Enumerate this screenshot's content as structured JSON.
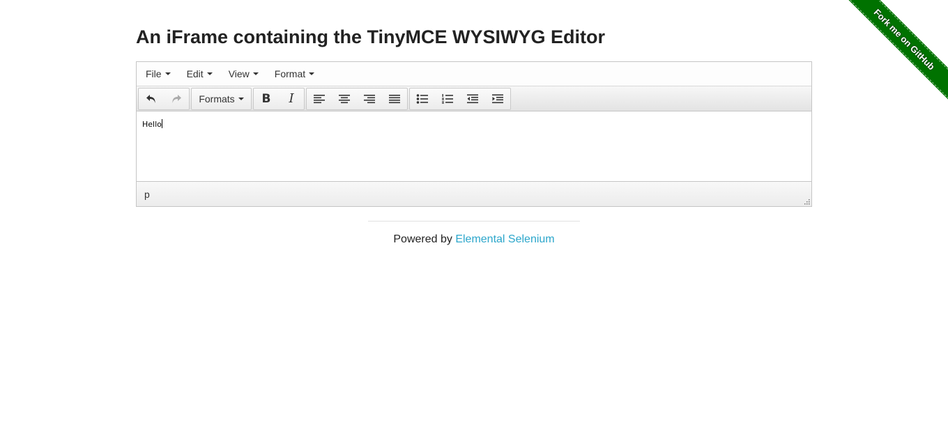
{
  "ribbon": {
    "label": "Fork me on GitHub",
    "color": "#007200"
  },
  "page": {
    "title": "An iFrame containing the TinyMCE WYSIWYG Editor"
  },
  "menubar": {
    "items": [
      {
        "label": "File"
      },
      {
        "label": "Edit"
      },
      {
        "label": "View"
      },
      {
        "label": "Format"
      }
    ]
  },
  "toolbar": {
    "formats_label": "Formats",
    "bold_glyph": "B",
    "italic_glyph": "I",
    "icons": [
      "undo-icon",
      "redo-icon",
      "bold-icon",
      "italic-icon",
      "align-left-icon",
      "align-center-icon",
      "align-right-icon",
      "align-justify-icon",
      "bullet-list-icon",
      "numbered-list-icon",
      "outdent-icon",
      "indent-icon"
    ]
  },
  "editor": {
    "content": "Hello"
  },
  "statusbar": {
    "path": "p"
  },
  "footer": {
    "prefix": "Powered by",
    "link_label": "Elemental Selenium",
    "link_color": "#2ba6cb"
  }
}
